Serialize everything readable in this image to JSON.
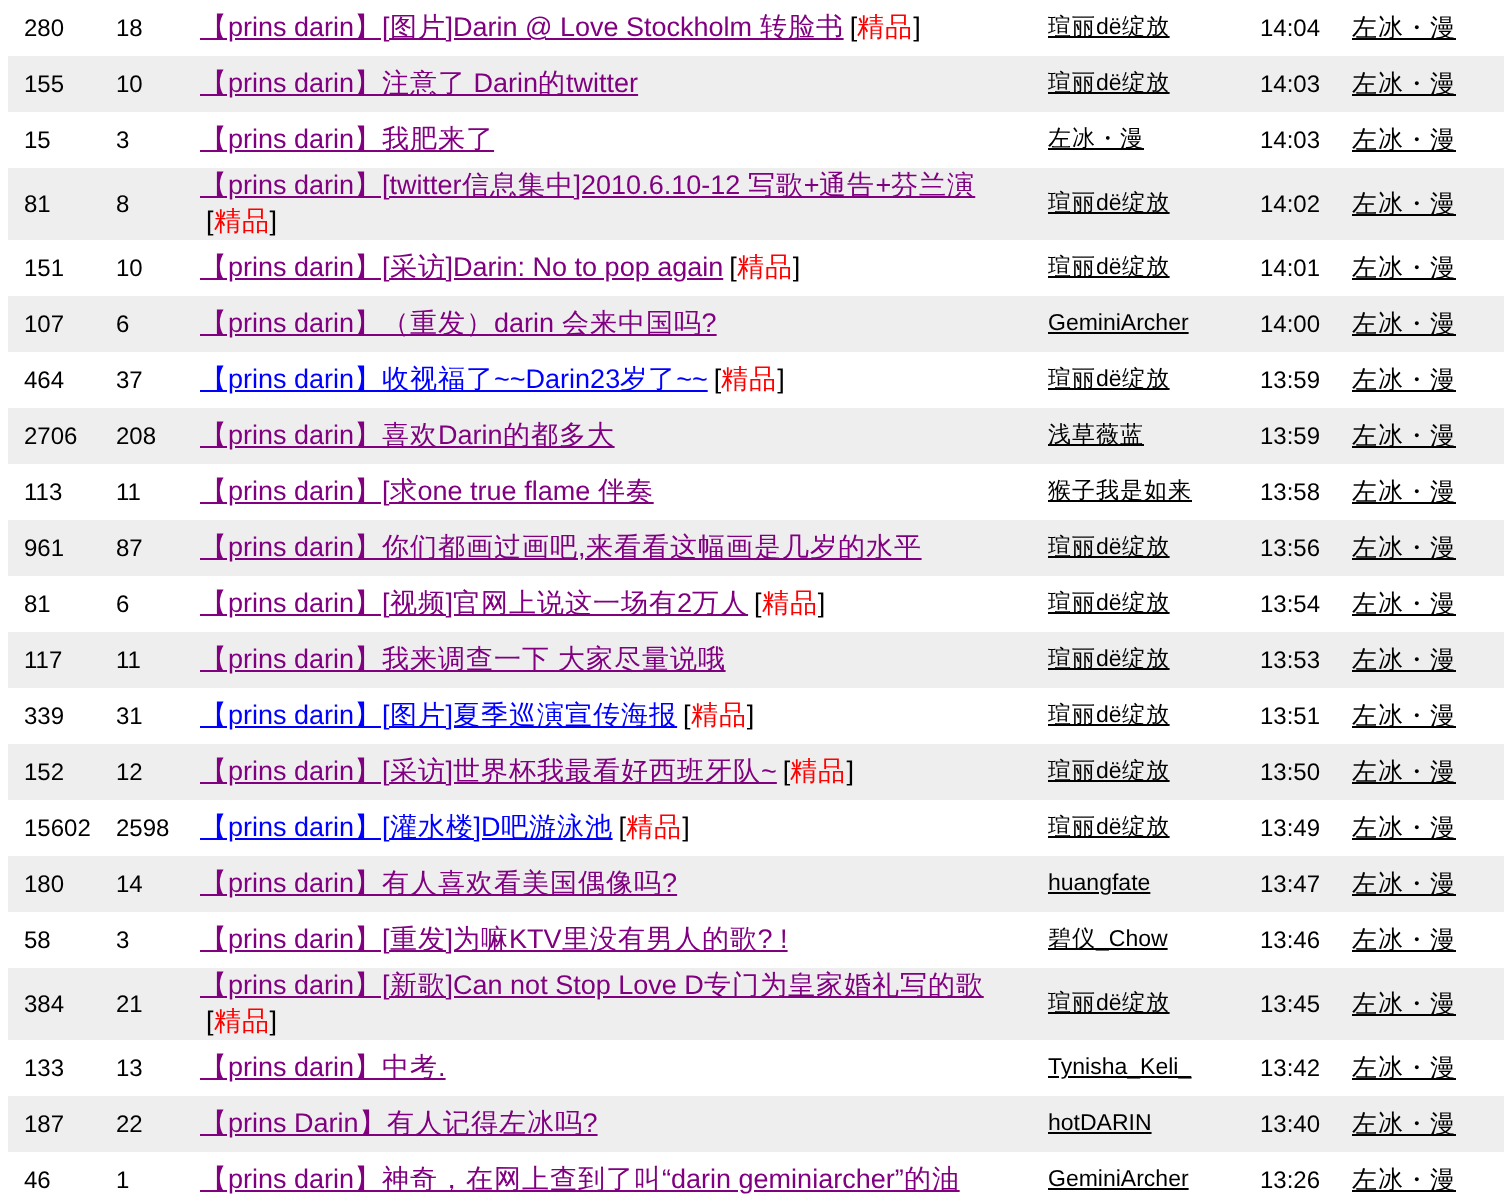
{
  "rows": [
    {
      "replies": "280",
      "clicks": "18",
      "title": "【prins darin】[图片]Darin @ Love Stockholm 转脸书",
      "visited": true,
      "elite": {
        "open": "[",
        "label": "精品",
        "close": "]"
      },
      "author": "瑄丽dё绽放",
      "time": "14:04",
      "last_reply": "左冰・漫"
    },
    {
      "replies": "155",
      "clicks": "10",
      "title": "【prins darin】注意了  Darin的twitter",
      "visited": true,
      "author": "瑄丽dё绽放",
      "time": "14:03",
      "last_reply": "左冰・漫"
    },
    {
      "replies": "15",
      "clicks": "3",
      "title": "【prins darin】我肥来了",
      "visited": true,
      "author": "左冰・漫",
      "time": "14:03",
      "last_reply": "左冰・漫"
    },
    {
      "replies": "81",
      "clicks": "8",
      "title": "【prins darin】[twitter信息集中]2010.6.10-12 写歌+通告+芬兰演",
      "visited": true,
      "elite": {
        "open": "[",
        "label": "精品",
        "close": "]"
      },
      "author": "瑄丽dё绽放",
      "time": "14:02",
      "last_reply": "左冰・漫"
    },
    {
      "replies": "151",
      "clicks": "10",
      "title": "【prins darin】[采访]Darin: No to pop again",
      "visited": true,
      "elite": {
        "open": "[",
        "label": "精品",
        "close": "]"
      },
      "author": "瑄丽dё绽放",
      "time": "14:01",
      "last_reply": "左冰・漫"
    },
    {
      "replies": "107",
      "clicks": "6",
      "title": "【prins darin】（重发）darin 会来中国吗?",
      "visited": true,
      "author": "GeminiArcher",
      "time": "14:00",
      "last_reply": "左冰・漫"
    },
    {
      "replies": "464",
      "clicks": "37",
      "title": "【prins darin】收视福了~~Darin23岁了~~",
      "visited": false,
      "elite": {
        "open": "[",
        "label": "精品",
        "close": "]"
      },
      "author": "瑄丽dё绽放",
      "time": "13:59",
      "last_reply": "左冰・漫"
    },
    {
      "replies": "2706",
      "clicks": "208",
      "title": "【prins darin】喜欢Darin的都多大",
      "visited": true,
      "author": "浅草薇蓝",
      "time": "13:59",
      "last_reply": "左冰・漫"
    },
    {
      "replies": "113",
      "clicks": "11",
      "title": "【prins darin】[求one true flame 伴奏",
      "visited": true,
      "author": "猴子我是如来",
      "time": "13:58",
      "last_reply": "左冰・漫"
    },
    {
      "replies": "961",
      "clicks": "87",
      "title": "【prins darin】你们都画过画吧,来看看这幅画是几岁的水平",
      "visited": true,
      "author": "瑄丽dё绽放",
      "time": "13:56",
      "last_reply": "左冰・漫"
    },
    {
      "replies": "81",
      "clicks": "6",
      "title": "【prins darin】[视频]官网上说这一场有2万人",
      "visited": true,
      "elite": {
        "open": "[",
        "label": "精品",
        "close": "]"
      },
      "author": "瑄丽dё绽放",
      "time": "13:54",
      "last_reply": "左冰・漫"
    },
    {
      "replies": "117",
      "clicks": "11",
      "title": "【prins darin】我来调查一下  大家尽量说哦",
      "visited": true,
      "author": "瑄丽dё绽放",
      "time": "13:53",
      "last_reply": "左冰・漫"
    },
    {
      "replies": "339",
      "clicks": "31",
      "title": "【prins darin】[图片]夏季巡演宣传海报",
      "visited": false,
      "elite": {
        "open": "[",
        "label": "精品",
        "close": "]"
      },
      "author": "瑄丽dё绽放",
      "time": "13:51",
      "last_reply": "左冰・漫"
    },
    {
      "replies": "152",
      "clicks": "12",
      "title": "【prins darin】[采访]世界杯我最看好西班牙队~",
      "visited": true,
      "elite": {
        "open": "[",
        "label": "精品",
        "close": "]"
      },
      "author": "瑄丽dё绽放",
      "time": "13:50",
      "last_reply": "左冰・漫"
    },
    {
      "replies": "15602",
      "clicks": "2598",
      "title": "【prins darin】[灌水楼]D吧游泳池",
      "visited": false,
      "elite": {
        "open": "[",
        "label": "精品",
        "close": "]"
      },
      "author": "瑄丽dё绽放",
      "time": "13:49",
      "last_reply": "左冰・漫"
    },
    {
      "replies": "180",
      "clicks": "14",
      "title": "【prins darin】有人喜欢看美国偶像吗?",
      "visited": true,
      "author": "huangfate",
      "time": "13:47",
      "last_reply": "左冰・漫"
    },
    {
      "replies": "58",
      "clicks": "3",
      "title": "【prins darin】[重发]为嘛KTV里没有男人的歌? !",
      "visited": true,
      "author": "碧仪_Chow",
      "time": "13:46",
      "last_reply": "左冰・漫"
    },
    {
      "replies": "384",
      "clicks": "21",
      "title": "【prins darin】[新歌]Can not Stop Love D专门为皇家婚礼写的歌",
      "visited": true,
      "elite": {
        "open": "[",
        "label": "精品",
        "close": "]"
      },
      "author": "瑄丽dё绽放",
      "time": "13:45",
      "last_reply": "左冰・漫"
    },
    {
      "replies": "133",
      "clicks": "13",
      "title": "【prins darin】中考.",
      "visited": true,
      "author": "Tynisha_Keli_",
      "time": "13:42",
      "last_reply": "左冰・漫"
    },
    {
      "replies": "187",
      "clicks": "22",
      "title": "【prins Darin】有人记得左冰吗?",
      "visited": true,
      "author": "hotDARIN",
      "time": "13:40",
      "last_reply": "左冰・漫"
    },
    {
      "replies": "46",
      "clicks": "1",
      "title": "【prins darin】神奇，在网上查到了叫“darin geminiarcher”的油",
      "visited": true,
      "author": "GeminiArcher",
      "time": "13:26",
      "last_reply": "左冰・漫"
    }
  ]
}
